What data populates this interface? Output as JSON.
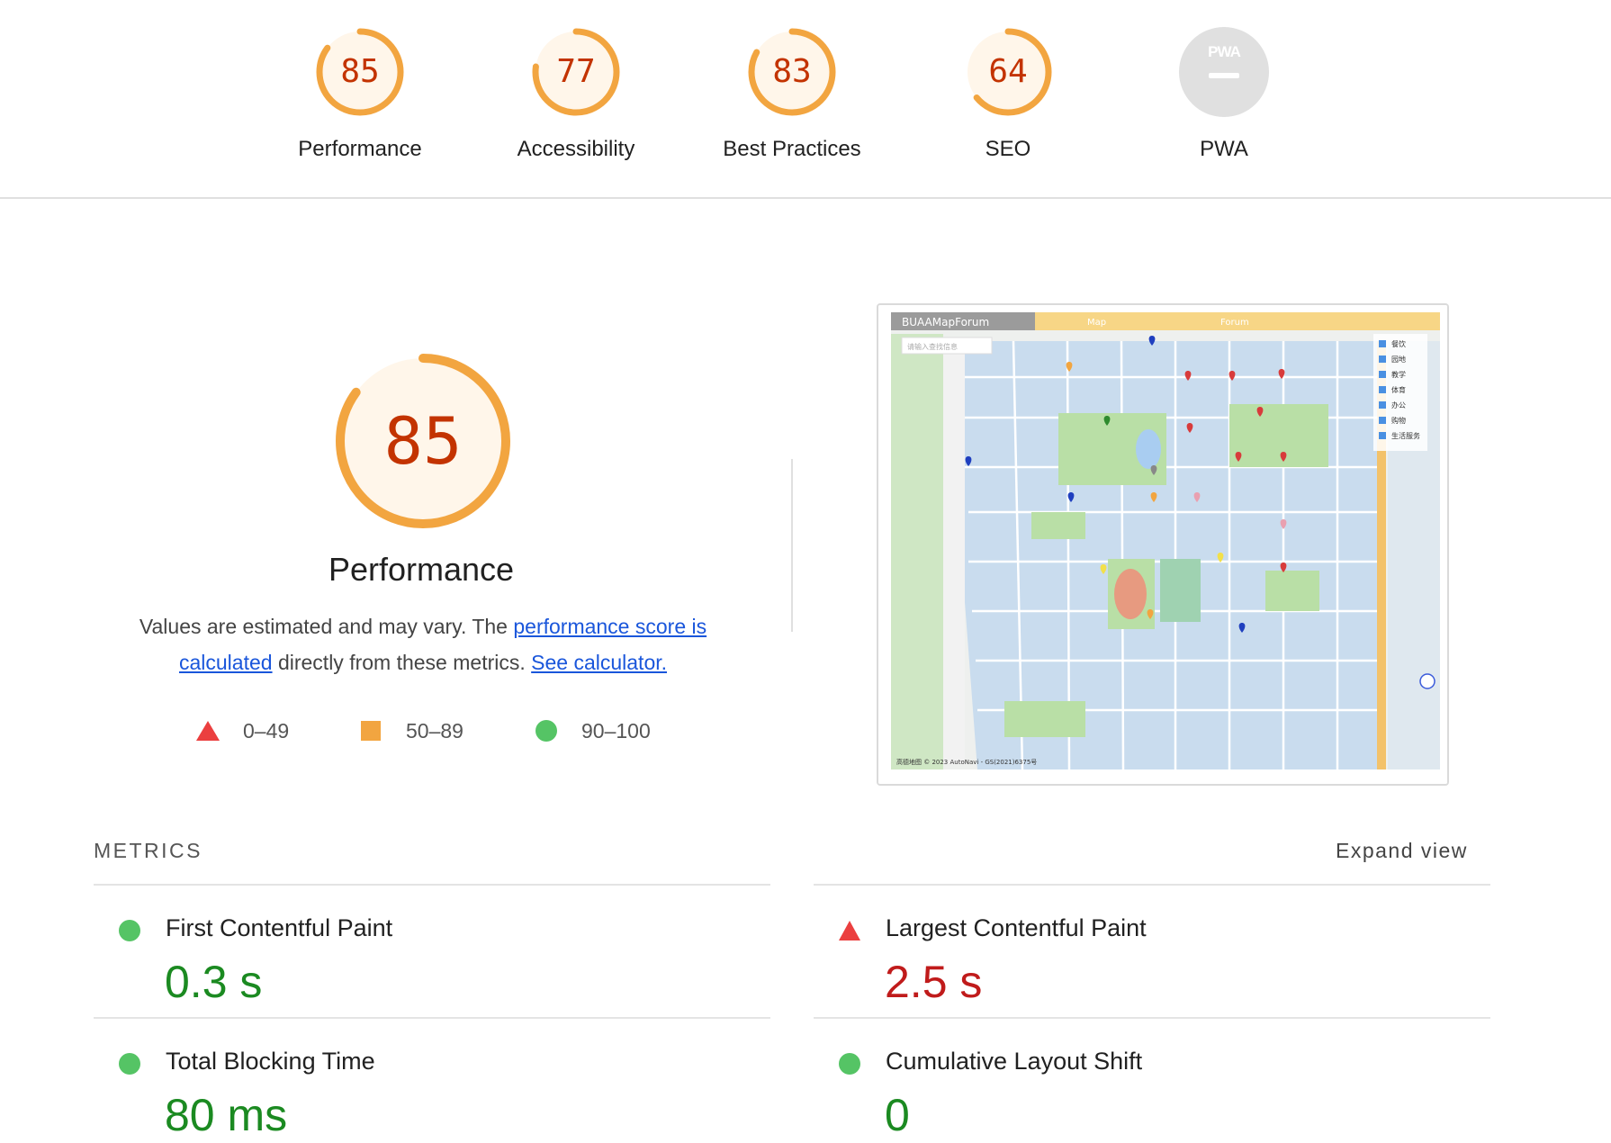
{
  "categories": [
    {
      "label": "Performance",
      "score": "85",
      "value": 0.85,
      "color": "#f2a540"
    },
    {
      "label": "Accessibility",
      "score": "77",
      "value": 0.77,
      "color": "#f2a540"
    },
    {
      "label": "Best Practices",
      "score": "83",
      "value": 0.83,
      "color": "#f2a540"
    },
    {
      "label": "SEO",
      "score": "64",
      "value": 0.64,
      "color": "#f2a540"
    },
    {
      "label": "PWA",
      "score": "",
      "badge_text": "PWA"
    }
  ],
  "performance": {
    "score": "85",
    "value": 0.85,
    "title": "Performance",
    "desc_prefix": "Values are estimated and may vary. The ",
    "desc_link1": "performance score is calculated",
    "desc_mid": " directly from these metrics. ",
    "desc_link2": "See calculator."
  },
  "legend": {
    "fail": "0–49",
    "average": "50–89",
    "pass": "90–100"
  },
  "screenshot": {
    "app_title": "BUAAMapForum",
    "tab_map": "Map",
    "tab_forum": "Forum",
    "search_placeholder": "请输入查找信息",
    "layers": [
      "餐饮",
      "园地",
      "教学",
      "体育",
      "办公",
      "购物",
      "生活服务"
    ],
    "copyright": "高德地图 © 2023 AutoNavi - GS(2021)6375号"
  },
  "metrics": {
    "header": "METRICS",
    "expand": "Expand view",
    "items": [
      {
        "label": "First Contentful Paint",
        "value": "0.3 s",
        "status": "pass"
      },
      {
        "label": "Largest Contentful Paint",
        "value": "2.5 s",
        "status": "fail"
      },
      {
        "label": "Total Blocking Time",
        "value": "80 ms",
        "status": "pass"
      },
      {
        "label": "Cumulative Layout Shift",
        "value": "0",
        "status": "pass"
      }
    ]
  },
  "colors": {
    "average": "#f2a540",
    "average_bg": "#fff6ea",
    "average_text": "#c33300",
    "pass": "#55c465",
    "pass_text": "#1b8a21",
    "fail": "#eb3f3f",
    "fail_text": "#c01b1b",
    "link": "#1a56db"
  }
}
